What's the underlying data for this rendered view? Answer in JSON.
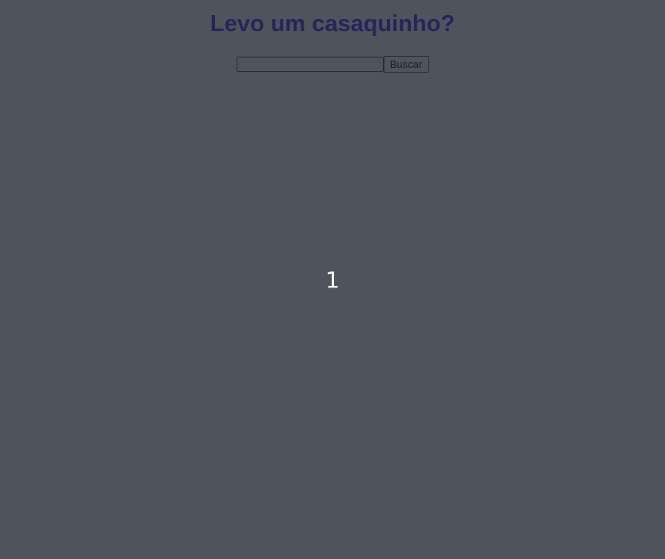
{
  "page": {
    "title": "Levo um casaquinho?"
  },
  "search": {
    "value": "",
    "placeholder": "",
    "button_label": "Buscar"
  },
  "result": {
    "value": "1"
  },
  "colors": {
    "background": "#4f535c",
    "title": "#26255a",
    "result_text": "#ffffff"
  }
}
